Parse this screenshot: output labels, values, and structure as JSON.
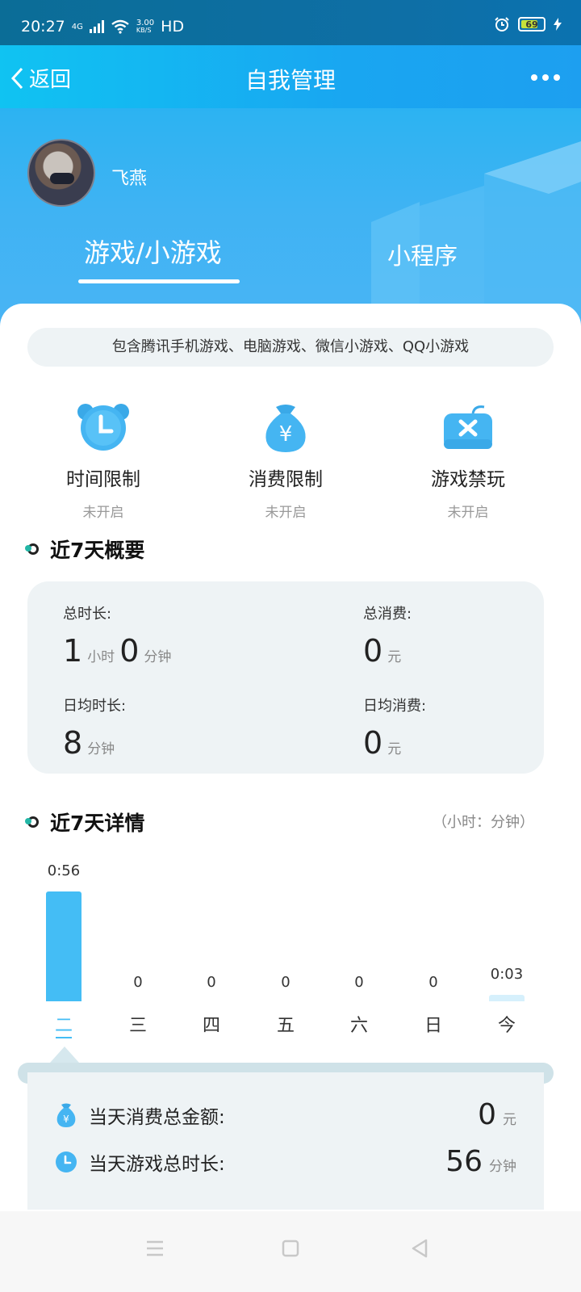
{
  "status_bar": {
    "time": "20:27",
    "network": "4G",
    "speed_value": "3.00",
    "speed_unit": "KB/S",
    "hd": "HD",
    "battery": "69"
  },
  "nav": {
    "back_label": "返回",
    "title": "自我管理"
  },
  "profile": {
    "username": "飞燕"
  },
  "tabs": [
    {
      "label": "游戏/小游戏",
      "active": true
    },
    {
      "label": "小程序",
      "active": false
    }
  ],
  "note": "包含腾讯手机游戏、电脑游戏、微信小游戏、QQ小游戏",
  "features": [
    {
      "icon": "alarm-clock-icon",
      "label": "时间限制",
      "status": "未开启"
    },
    {
      "icon": "money-bag-icon",
      "label": "消费限制",
      "status": "未开启"
    },
    {
      "icon": "game-ban-icon",
      "label": "游戏禁玩",
      "status": "未开启"
    }
  ],
  "summary": {
    "title": "近7天概要",
    "total_time_label": "总时长:",
    "total_time_hours": "1",
    "hours_unit": "小时",
    "total_time_minutes": "0",
    "minutes_unit": "分钟",
    "total_spend_label": "总消费:",
    "total_spend": "0",
    "yuan_unit": "元",
    "avg_time_label": "日均时长:",
    "avg_time": "8",
    "avg_spend_label": "日均消费:",
    "avg_spend": "0"
  },
  "details": {
    "title": "近7天详情",
    "units_note": "（小时：分钟）",
    "selected_day_index": 0
  },
  "chart_data": {
    "type": "bar",
    "categories": [
      "二",
      "三",
      "四",
      "五",
      "六",
      "日",
      "今"
    ],
    "values_minutes": [
      56,
      0,
      0,
      0,
      0,
      0,
      3
    ],
    "value_labels": [
      "0:56",
      "0",
      "0",
      "0",
      "0",
      "0",
      "0:03"
    ],
    "color": "#44bdf5",
    "title": "",
    "xlabel": "",
    "ylabel": ""
  },
  "day_detail": {
    "spend_label": "当天消费总金额:",
    "spend_value": "0",
    "spend_unit": "元",
    "time_label": "当天游戏总时长:",
    "time_value": "56",
    "time_unit": "分钟"
  },
  "colors": {
    "accent": "#44bdf5",
    "header": "#19a6f1"
  }
}
